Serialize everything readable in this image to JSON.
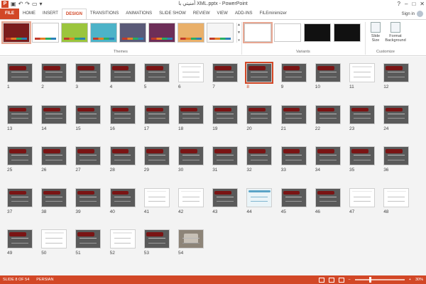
{
  "titlebar": {
    "title": "أمنيتي با XML.pptx - PowerPoint",
    "minimize": "‒",
    "restore": "□",
    "close": "✕",
    "help": "?"
  },
  "tabs": [
    {
      "label": "FILE"
    },
    {
      "label": "HOME"
    },
    {
      "label": "INSERT"
    },
    {
      "label": "DESIGN"
    },
    {
      "label": "TRANSITIONS"
    },
    {
      "label": "ANIMATIONS"
    },
    {
      "label": "SLIDE SHOW"
    },
    {
      "label": "REVIEW"
    },
    {
      "label": "VIEW"
    },
    {
      "label": "ADD-INS"
    },
    {
      "label": "FILEminimizer"
    }
  ],
  "signin": "Sign in",
  "ribbon": {
    "themes_label": "Themes",
    "variants_label": "Variants",
    "customize_label": "Customize",
    "slide_size": "Slide Size",
    "format_background": "Format Background",
    "theme_colors": [
      "#7b1c1c",
      "#ffffff",
      "#9bc53d",
      "#4cb3c8",
      "#5a5a78",
      "#6d2e58",
      "#e9b06a",
      "#f5f5f5"
    ],
    "variant_colors": [
      "#ffffff",
      "#ffffff",
      "#111111",
      "#111111"
    ]
  },
  "slides": [
    {
      "n": "1"
    },
    {
      "n": "2"
    },
    {
      "n": "3"
    },
    {
      "n": "4"
    },
    {
      "n": "5"
    },
    {
      "n": "6"
    },
    {
      "n": "7"
    },
    {
      "n": "8"
    },
    {
      "n": "9"
    },
    {
      "n": "10"
    },
    {
      "n": "11"
    },
    {
      "n": "12"
    },
    {
      "n": "13"
    },
    {
      "n": "14"
    },
    {
      "n": "15"
    },
    {
      "n": "16"
    },
    {
      "n": "17"
    },
    {
      "n": "18"
    },
    {
      "n": "19"
    },
    {
      "n": "20"
    },
    {
      "n": "21"
    },
    {
      "n": "22"
    },
    {
      "n": "23"
    },
    {
      "n": "24"
    },
    {
      "n": "25"
    },
    {
      "n": "26"
    },
    {
      "n": "27"
    },
    {
      "n": "28"
    },
    {
      "n": "29"
    },
    {
      "n": "30"
    },
    {
      "n": "31"
    },
    {
      "n": "32"
    },
    {
      "n": "33"
    },
    {
      "n": "34"
    },
    {
      "n": "35"
    },
    {
      "n": "36"
    },
    {
      "n": "37"
    },
    {
      "n": "38"
    },
    {
      "n": "39"
    },
    {
      "n": "40"
    },
    {
      "n": "41"
    },
    {
      "n": "42"
    },
    {
      "n": "43"
    },
    {
      "n": "44"
    },
    {
      "n": "45"
    },
    {
      "n": "46"
    },
    {
      "n": "47"
    },
    {
      "n": "48"
    },
    {
      "n": "49"
    },
    {
      "n": "50"
    },
    {
      "n": "51"
    },
    {
      "n": "52"
    },
    {
      "n": "53"
    },
    {
      "n": "54"
    }
  ],
  "selected_slide": 8,
  "statusbar": {
    "slide_info": "SLIDE 8 OF 54",
    "language": "PERSIAN",
    "zoom": "30%",
    "zoom_fraction": 0.3,
    "minus": "−",
    "plus": "+"
  }
}
